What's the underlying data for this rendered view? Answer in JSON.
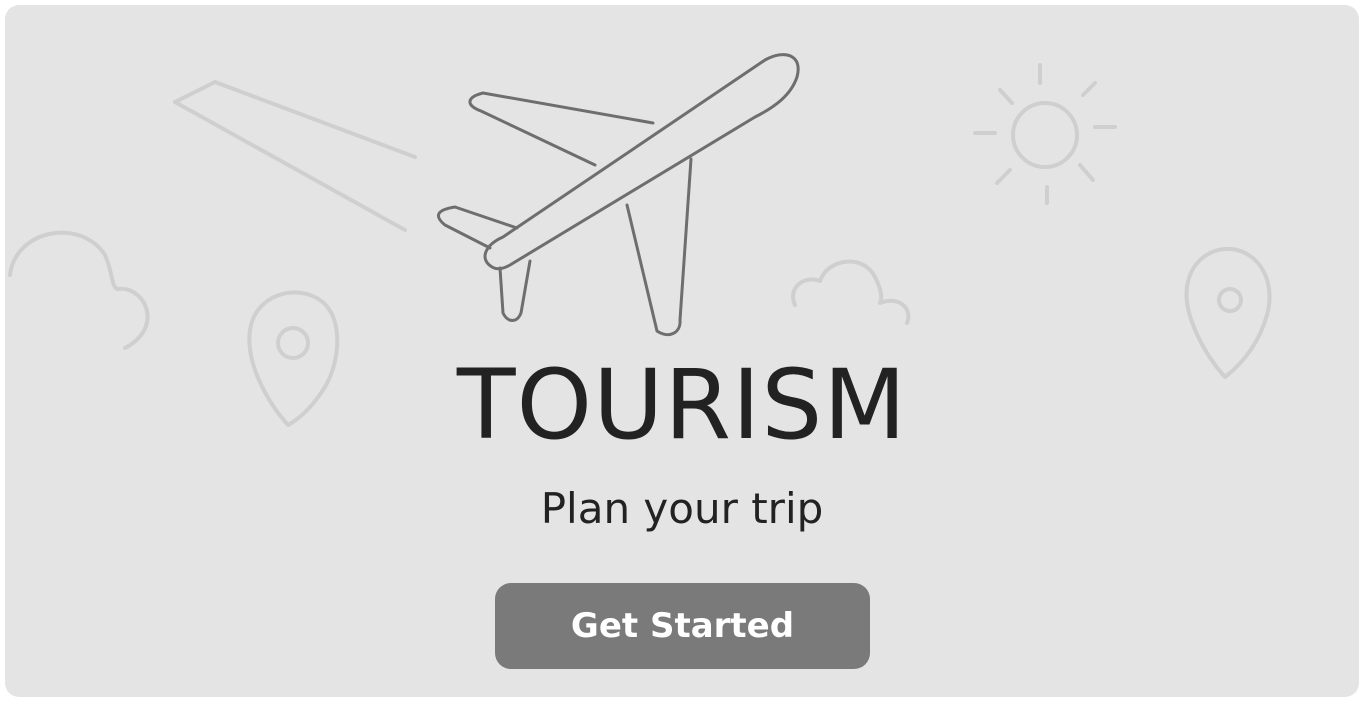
{
  "hero": {
    "title": "TOURISM",
    "subtitle": "Plan your trip",
    "cta_label": "Get Started"
  },
  "icons": [
    "airplane-icon",
    "cloud-icon",
    "location-pin-icon",
    "sun-icon"
  ],
  "colors": {
    "background": "#e4e4e4",
    "button": "#7a7a7a",
    "button_text": "#ffffff",
    "title_text": "#222222",
    "plane_stroke": "#6e6e6e",
    "decor_stroke": "#cfcfcf"
  }
}
